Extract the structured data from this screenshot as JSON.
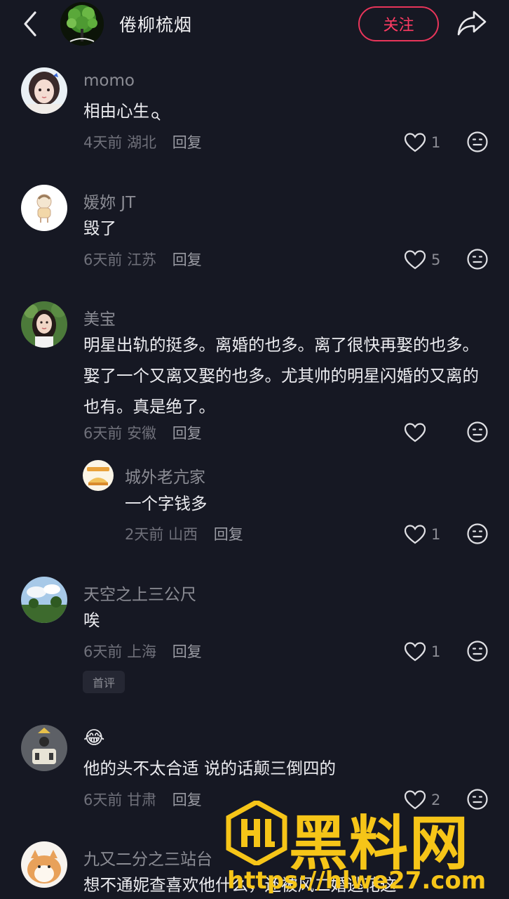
{
  "header": {
    "title": "倦柳梳烟",
    "follow_label": "关注"
  },
  "comments": [
    {
      "name": "momo",
      "text": "相由心生",
      "time": "4天前",
      "location": "湖北",
      "reply_label": "回复",
      "likes": "1"
    },
    {
      "name": "媛妳 JT",
      "text": "毁了",
      "time": "6天前",
      "location": "江苏",
      "reply_label": "回复",
      "likes": "5"
    },
    {
      "name": "美宝",
      "text": "明星出轨的挺多。离婚的也多。离了很快再娶的也多。娶了一个又离又娶的也多。尤其帅的明星闪婚的又离的也有。真是绝了。",
      "time": "6天前",
      "location": "安徽",
      "reply_label": "回复",
      "likes": ""
    },
    {
      "name": "城外老亢家",
      "text": "一个字钱多",
      "time": "2天前",
      "location": "山西",
      "reply_label": "回复",
      "likes": "1"
    },
    {
      "name": "天空之上三公尺",
      "text": "唉",
      "time": "6天前",
      "location": "上海",
      "reply_label": "回复",
      "likes": "1",
      "badge": "首评"
    },
    {
      "name": "😂",
      "text": "他的头不太合适 说的话颠三倒四的",
      "time": "6天前",
      "location": "甘肃",
      "reply_label": "回复",
      "likes": "2"
    },
    {
      "name": "九又二分之三站台",
      "text": "想不通妮查喜欢他什么，还被风二婚逃花这"
    }
  ],
  "watermark": {
    "text": "黑料网",
    "url": "https://hlwe27.com"
  },
  "icons": {
    "back": "chevron-left-icon",
    "share": "share-arrow-icon",
    "like": "heart-outline-icon",
    "dislike": "meh-face-icon",
    "search_hint": "search-small-icon"
  },
  "colors": {
    "background": "#161823",
    "accent": "#ff3b63",
    "watermark": "#f6c518"
  }
}
